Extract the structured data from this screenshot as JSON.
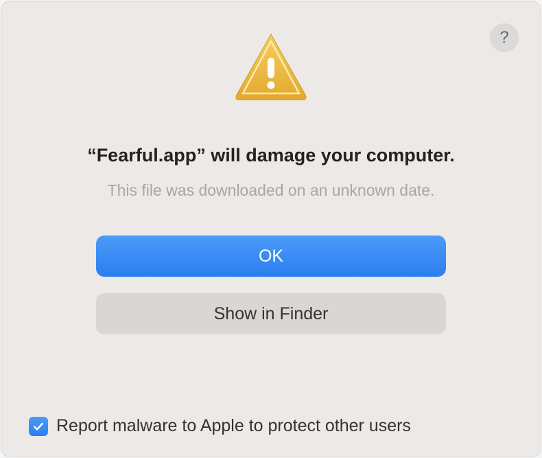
{
  "dialog": {
    "help_label": "?",
    "headline": "“Fearful.app” will damage your computer.",
    "subtext": "This file was downloaded on an unknown date.",
    "primary_button": "OK",
    "secondary_button": "Show in Finder",
    "checkbox_label": "Report malware to Apple to protect other users",
    "checkbox_checked": true
  },
  "icons": {
    "warning": "warning-triangle-icon",
    "help": "question-icon",
    "checkmark": "checkmark-icon"
  }
}
